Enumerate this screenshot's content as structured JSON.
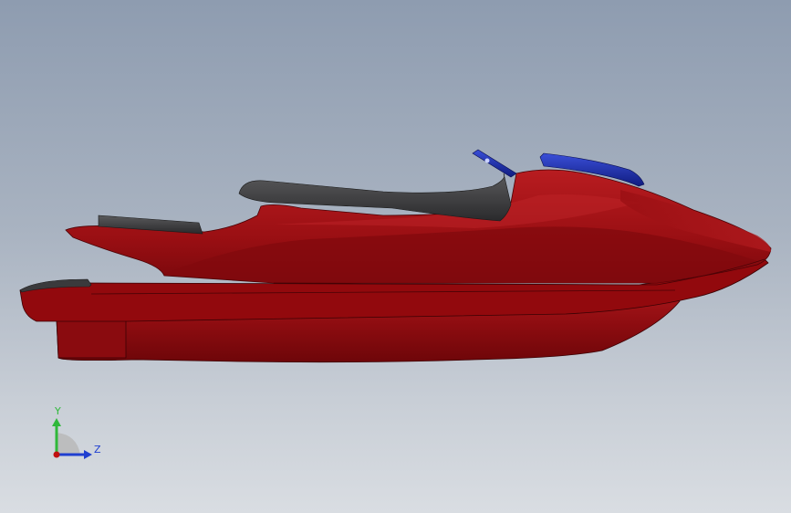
{
  "viewport": {
    "background_top": "#8e9cb0",
    "background_bottom": "#d9dde2"
  },
  "model": {
    "name": "jet-ski",
    "body_color": "#9b0e12",
    "seat_color": "#3a3a3c",
    "handlebar_color": "#1f2fb0"
  },
  "triad": {
    "y_label": "Y",
    "z_label": "Z",
    "y_color": "#2fb83a",
    "z_color": "#1f3fd0",
    "origin_color": "#c01010"
  }
}
